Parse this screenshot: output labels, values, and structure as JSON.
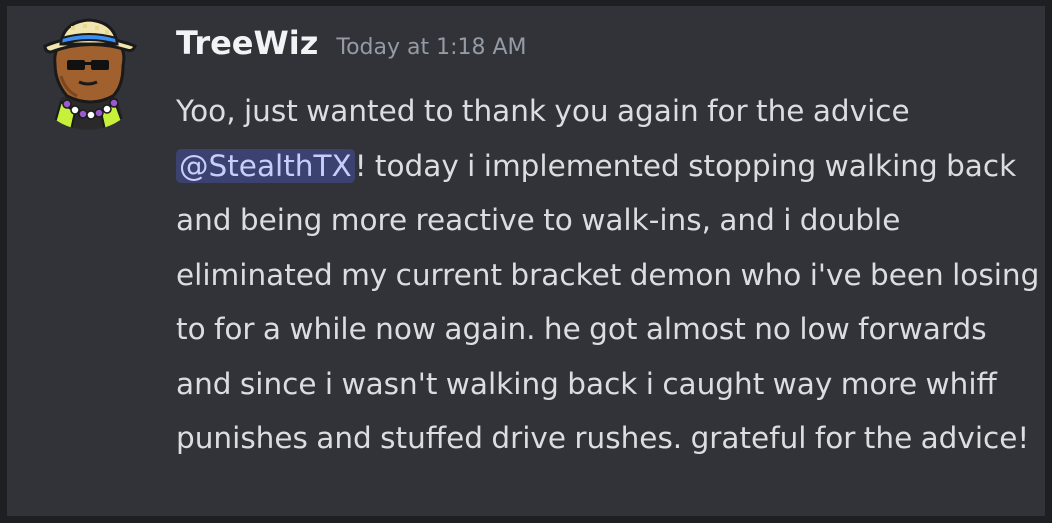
{
  "message": {
    "username": "TreeWiz",
    "timestamp": "Today at 1:18 AM",
    "text_before_mention": "Yoo, just wanted to thank you again for the advice ",
    "mention": "@StealthTX",
    "text_after_mention": "! today i implemented stopping walking back and being more reactive to walk-ins, and i double eliminated my current bracket demon who i've been losing to for a while now again. he got almost no low forwards and since i wasn't walking back i caught way more whiff punishes and stuffed drive rushes. grateful for the advice!"
  },
  "colors": {
    "background": "#313338",
    "username": "#f2f3f5",
    "timestamp": "#949ba4",
    "text": "#dbdee1",
    "mention_bg": "#3c4270",
    "mention_text": "#c9cdfb"
  }
}
